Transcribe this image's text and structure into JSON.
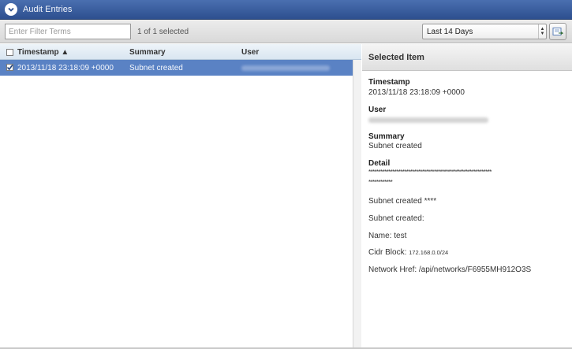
{
  "window": {
    "title": "Audit Entries"
  },
  "toolbar": {
    "filter_placeholder": "Enter Filter Terms",
    "selected_count": "1 of 1 selected",
    "range_select_value": "Last 14 Days"
  },
  "table": {
    "columns": [
      "Timestamp ▲",
      "Summary",
      "User"
    ],
    "rows": [
      {
        "timestamp": "2013/11/18 23:18:09 +0000",
        "summary": "Subnet created",
        "user": "",
        "checked": true
      }
    ]
  },
  "detail": {
    "header": "Selected Item",
    "timestamp_label": "Timestamp",
    "timestamp_value": "2013/11/18 23:18:09 +0000",
    "user_label": "User",
    "summary_label": "Summary",
    "summary_value": "Subnet created",
    "detail_label": "Detail",
    "detail_stars_line1": "**************************************************************",
    "detail_stars_line2": "************",
    "detail_lines": {
      "l1": "Subnet created ****",
      "l2": "Subnet created:",
      "l3": "Name: test",
      "l4_prefix": "Cidr Block: ",
      "l4_value": "172.168.0.0/24",
      "l5": "Network Href: /api/networks/F6955MH912O3S"
    }
  },
  "colors": {
    "titlebar": "#2d4f8f",
    "selected_row": "#5a82c4",
    "header_bg": "#d9e6f1"
  }
}
